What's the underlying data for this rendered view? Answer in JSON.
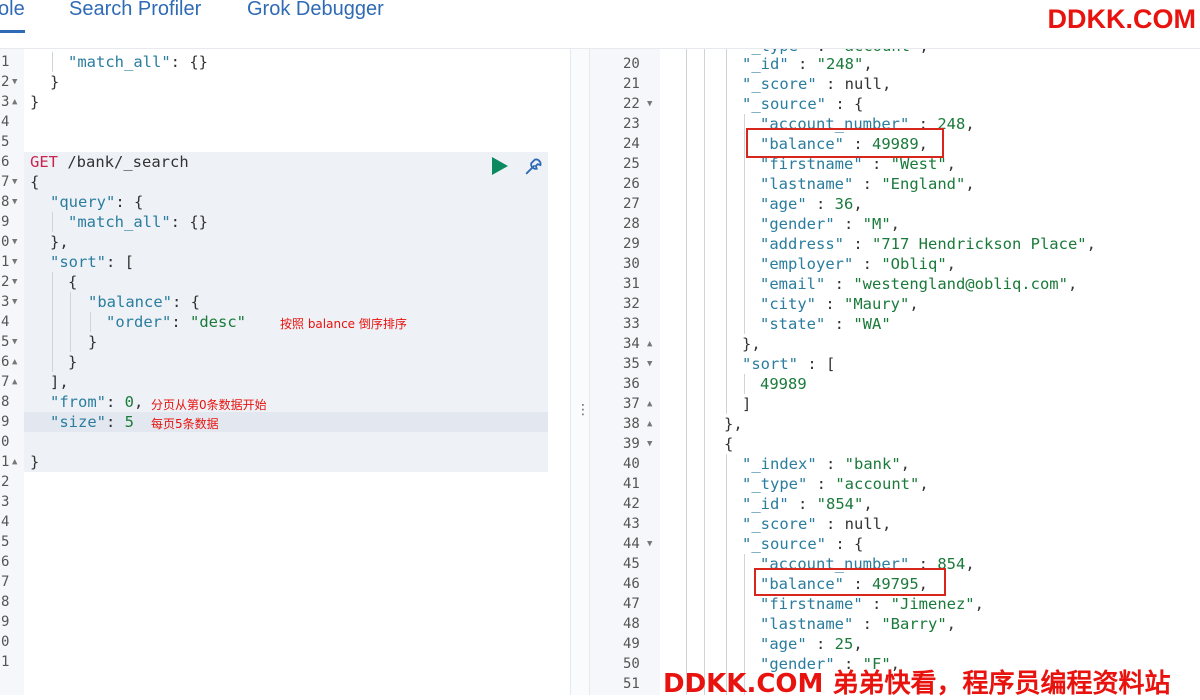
{
  "tabs": [
    {
      "label": "ole"
    },
    {
      "label": "Search Profiler"
    },
    {
      "label": "Grok Debugger"
    }
  ],
  "watermark_top": "DDKK.COM",
  "watermark_bottom": "DDKK.COM 弟弟快看，程序员编程资料站",
  "left_editor": {
    "line_numbers": [
      "1",
      "2",
      "3",
      "4",
      "5",
      "6",
      "7",
      "8",
      "9",
      "0",
      "1",
      "2",
      "3",
      "4",
      "5",
      "6",
      "7",
      "8",
      "9",
      "0",
      "1",
      "2",
      "3",
      "4",
      "5",
      "6",
      "7",
      "8",
      "9",
      "0",
      "1"
    ],
    "request_method": "GET",
    "request_url": "/bank/_search",
    "annotations": {
      "order_note": "按照 balance 倒序排序",
      "from_note": "分页从第0条数据开始",
      "size_note": "每页5条数据"
    }
  },
  "right_editor": {
    "line_numbers": [
      "20",
      "21",
      "22",
      "23",
      "24",
      "25",
      "26",
      "27",
      "28",
      "29",
      "30",
      "31",
      "32",
      "33",
      "34",
      "35",
      "36",
      "37",
      "38",
      "39",
      "40",
      "41",
      "42",
      "43",
      "44",
      "45",
      "46",
      "47",
      "48",
      "49",
      "50",
      "51"
    ],
    "doc1": {
      "_id": "\"248\"",
      "account_number": "248",
      "balance": "49989",
      "firstname": "\"West\"",
      "lastname": "\"England\"",
      "age": "36",
      "gender": "\"M\"",
      "address": "\"717 Hendrickson Place\"",
      "employer": "\"Obliq\"",
      "email": "\"westengland@obliq.com\"",
      "city": "\"Maury\"",
      "state": "\"WA\"",
      "sort_value": "49989"
    },
    "doc2": {
      "_index": "\"bank\"",
      "_type": "\"account\"",
      "_id": "\"854\"",
      "account_number": "854",
      "balance": "49795",
      "firstname": "\"Jimenez\"",
      "lastname": "\"Barry\"",
      "age": "25",
      "gender": "\"F\""
    }
  }
}
